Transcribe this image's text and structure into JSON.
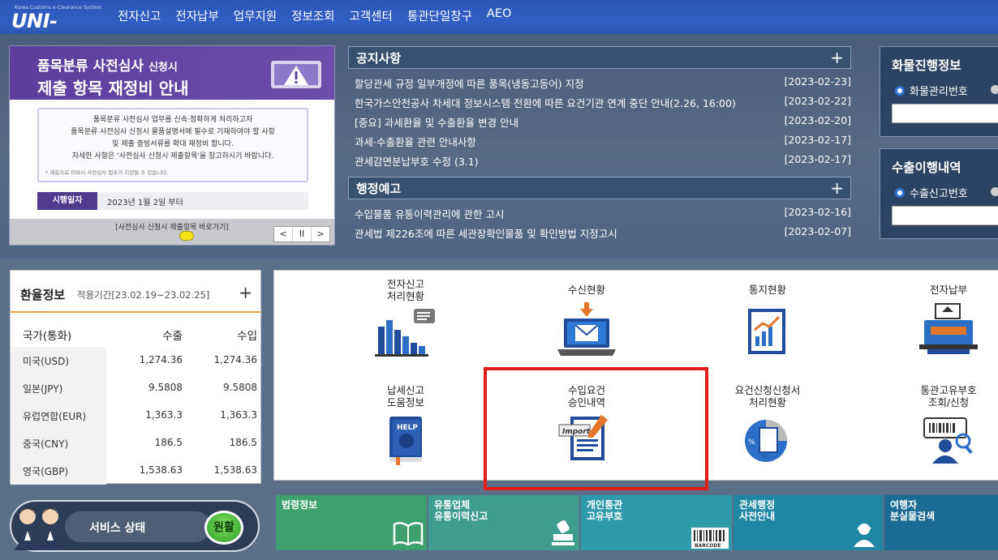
{
  "brand": {
    "logo_text": "UNI-PASS",
    "logo_sub": "Korea Customs e-Clearance System"
  },
  "nav": [
    "전자신고",
    "전자납부",
    "업무지원",
    "정보조회",
    "고객센터",
    "통관단일창구",
    "AEO"
  ],
  "banner": {
    "title_line1": "품목분류 사전심사",
    "title_line1_small": "신청시",
    "title_line2": "제출 항목 재정비 안내",
    "body": [
      "품목분류 사전심사 업무를 신속·정확하게 처리하고자",
      "품목분류 사전심사 신청시 물품설명서에 필수로 기재하여야 할 사항",
      "및 제출 증빙서류를 확대 재정비 합니다.",
      "자세한 사항은 '사전심사 신청시 제출항목'을 참고하시기 바랍니다."
    ],
    "note": "* 제출자료 미비시 사전심사 접수가 지연될 수 있습니다.",
    "date_tag": "시행일자",
    "date_text": "2023년 1월 2일 부터",
    "footer_link": "[사전심사 신청시 제출항목 바로가기]",
    "controls": [
      "<",
      "II",
      ">"
    ]
  },
  "notices": {
    "title": "공지사항",
    "plus": "+",
    "items": [
      {
        "text": "할당관세 규정 일부개정에 따른 품목(냉동고등어) 지정",
        "date": "[2023-02-23]"
      },
      {
        "text": "한국가스안전공사 차세대 정보시스템 전환에 따른 요건기관 연계 중단 안내(2.26, 16:00)",
        "date": "[2023-02-22]"
      },
      {
        "text": "[중요] 과세환율 및 수출환율 변경 안내",
        "date": "[2023-02-20]"
      },
      {
        "text": "과세·수출환율 관련 안내사항",
        "date": "[2023-02-17]"
      },
      {
        "text": "관세감면분납부호 수정 (3.1)",
        "date": "[2023-02-17]"
      }
    ]
  },
  "admin_notices": {
    "title": "행정예고",
    "plus": "+",
    "items": [
      {
        "text": "수입물품 유통이력관리에 관한 고시",
        "date": "[2023-02-16]"
      },
      {
        "text": "관세법 제226조에 따른 세관장확인물품 및 확인방법 지정고시",
        "date": "[2023-02-07]"
      }
    ]
  },
  "cargo": {
    "title": "화물진행정보",
    "radio_label": "화물관리번호"
  },
  "export": {
    "title": "수출이행내역",
    "radio_label": "수출신고번호"
  },
  "fx": {
    "title": "환율정보",
    "period": "적용기간[23.02.19~23.02.25]",
    "plus": "+",
    "headers": [
      "국가(통화)",
      "수출",
      "수입"
    ],
    "rows": [
      [
        "미국(USD)",
        "1,274.36",
        "1,274.36"
      ],
      [
        "일본(JPY)",
        "9.5808",
        "9.5808"
      ],
      [
        "유럽연합(EUR)",
        "1,363.3",
        "1,363.3"
      ],
      [
        "중국(CNY)",
        "186.5",
        "186.5"
      ],
      [
        "영국(GBP)",
        "1,538.63",
        "1,538.63"
      ]
    ]
  },
  "services": [
    {
      "line1": "전자신고",
      "line2": "처리현황"
    },
    {
      "line1": "수신현황",
      "line2": ""
    },
    {
      "line1": "통지현황",
      "line2": ""
    },
    {
      "line1": "전자납부",
      "line2": ""
    },
    {
      "line1": "납세신고",
      "line2": "도움정보"
    },
    {
      "line1": "수입요건",
      "line2": "승인내역"
    },
    {
      "line1": "요건신청신청서",
      "line2": "처리현황"
    },
    {
      "line1": "통관고유부호",
      "line2": "조회/신청"
    }
  ],
  "icon_text": {
    "help": "HELP",
    "import": "Import",
    "barcode": "BARCODE"
  },
  "status": {
    "label": "서비스 상태",
    "value": "원활"
  },
  "quick_links": [
    {
      "line1": "법령정보",
      "line2": "",
      "color": "#3fa06f"
    },
    {
      "line1": "유통업체",
      "line2": "유통이력신고",
      "color": "#3e9d8f"
    },
    {
      "line1": "개인통관",
      "line2": "고유부호",
      "color": "#2f9aa9"
    },
    {
      "line1": "관세행정",
      "line2": "사전안내",
      "color": "#1f86a4"
    },
    {
      "line1": "여행자",
      "line2": "분실물검색",
      "color": "#1b6c94"
    }
  ]
}
